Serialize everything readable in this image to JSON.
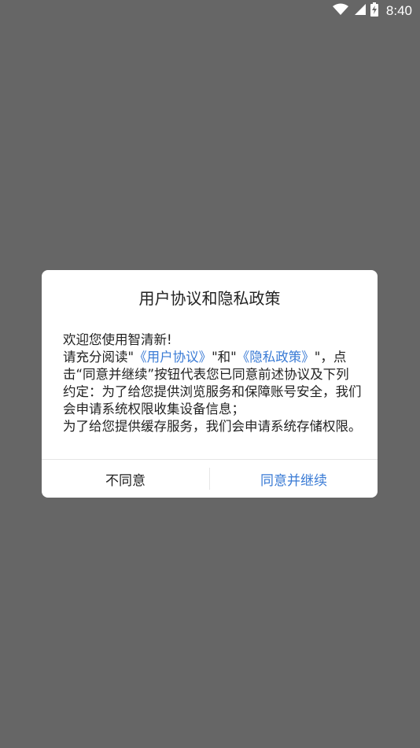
{
  "status_bar": {
    "time": "8:40",
    "icons": [
      "wifi-icon",
      "signal-icon",
      "battery-charging-icon"
    ]
  },
  "dialog": {
    "title": "用户协议和隐私政策",
    "body": {
      "welcome": "欢迎您使用智清新!",
      "read_prefix": "请充分阅读\"",
      "user_agreement_link": "《用户协议》",
      "and_text": "\"和\"",
      "privacy_policy_link": "《隐私政策》",
      "read_suffix": "\"，",
      "paragraph_rest": "点击“同意并继续”按钮代表您已同意前述协议及下列约定：为了给您提供浏览服务和保障账号安全，我们会申请系统权限收集设备信息；",
      "cache_notice": "为了给您提供缓存服务，我们会申请系统存储权限。"
    },
    "buttons": {
      "disagree": "不同意",
      "agree": "同意并继续"
    }
  },
  "colors": {
    "overlay": "#666666",
    "link": "#3a7bd5",
    "text": "#222222"
  }
}
